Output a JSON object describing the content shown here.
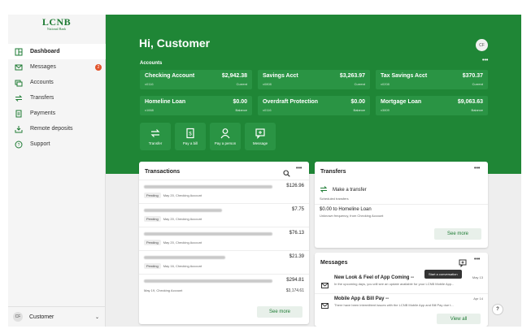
{
  "brand": {
    "name": "LCNB",
    "sub": "National Bank"
  },
  "sidebar": {
    "items": [
      {
        "label": "Dashboard",
        "icon": "dashboard-icon"
      },
      {
        "label": "Messages",
        "icon": "mail-icon",
        "badge": "2"
      },
      {
        "label": "Accounts",
        "icon": "accounts-icon"
      },
      {
        "label": "Transfers",
        "icon": "transfer-icon"
      },
      {
        "label": "Payments",
        "icon": "payments-icon"
      },
      {
        "label": "Remote deposits",
        "icon": "download-icon"
      },
      {
        "label": "Support",
        "icon": "help-icon"
      }
    ],
    "user": {
      "initials": "CF",
      "name": "Customer"
    }
  },
  "header": {
    "greeting": "Hi, Customer",
    "avatar": "CF"
  },
  "accounts": {
    "title": "Accounts",
    "more": "•••",
    "items": [
      {
        "name": "Checking Account",
        "number": "x0116",
        "balance": "$2,942.38",
        "label": "Current"
      },
      {
        "name": "Savings Acct",
        "number": "x0808",
        "balance": "$3,263.97",
        "label": "Current"
      },
      {
        "name": "Tax Savings Acct",
        "number": "x0208",
        "balance": "$370.37",
        "label": "Current"
      },
      {
        "name": "Homeline Loan",
        "number": "x1668",
        "balance": "$0.00",
        "label": "Balance"
      },
      {
        "name": "Overdraft Protection",
        "number": "x0116",
        "balance": "$0.00",
        "label": "Balance"
      },
      {
        "name": "Mortgage Loan",
        "number": "x3809",
        "balance": "$9,063.63",
        "label": "Balance"
      }
    ]
  },
  "actions": [
    {
      "label": "Transfer",
      "icon": "transfer-icon"
    },
    {
      "label": "Pay a bill",
      "icon": "bill-icon"
    },
    {
      "label": "Pay a person",
      "icon": "person-icon"
    },
    {
      "label": "Message",
      "icon": "message-icon"
    }
  ],
  "transactions": {
    "title": "Transactions",
    "more_label": "See more",
    "rows": [
      {
        "amount": "$126.96",
        "status": "Pending",
        "meta": "May 20, Checking Account",
        "balance": ""
      },
      {
        "amount": "$7.75",
        "status": "Pending",
        "meta": "May 20, Checking Account",
        "balance": ""
      },
      {
        "amount": "$76.13",
        "status": "Pending",
        "meta": "May 20, Checking Account",
        "balance": ""
      },
      {
        "amount": "$21.39",
        "status": "Pending",
        "meta": "May 16, Checking Account",
        "balance": ""
      },
      {
        "amount": "$294.81",
        "status": "",
        "meta": "May 19, Checking Account",
        "balance": "$3,174.61"
      }
    ]
  },
  "transfers": {
    "title": "Transfers",
    "make": "Make a transfer",
    "scheduled": "Scheduled transfers",
    "item_title": "$0.00 to Homeline Loan",
    "item_sub": "Unknown frequency, from Checking Account",
    "more_label": "See more"
  },
  "messages": {
    "title": "Messages",
    "tooltip": "Start a conversation",
    "view_all": "View all",
    "items": [
      {
        "title": "New Look & Feel of App Coming --",
        "date": "May 13",
        "body": "In the upcoming days, you will see an update available for your LCNB Mobile App..."
      },
      {
        "title": "Mobile App & Bill Pay --",
        "date": "Apr 14",
        "body": "There have been intermittent issues with the LCNB Mobile App and Bill Pay due t..."
      }
    ]
  },
  "help": "?"
}
